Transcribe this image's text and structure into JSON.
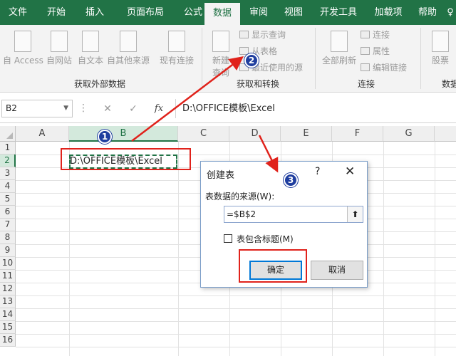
{
  "ribbon_tabs": [
    {
      "label": "文件"
    },
    {
      "label": "开始"
    },
    {
      "label": "插入"
    },
    {
      "label": "页面布局"
    },
    {
      "label": "公式"
    },
    {
      "label": "数据"
    },
    {
      "label": "审阅"
    },
    {
      "label": "视图"
    },
    {
      "label": "开发工具"
    },
    {
      "label": "加载项"
    },
    {
      "label": "帮助"
    },
    {
      "label": "♀"
    }
  ],
  "active_tab": "数据",
  "ribbon": {
    "external_data": {
      "group_label": "获取外部数据",
      "buttons": [
        {
          "label": "自 Access"
        },
        {
          "label": "自网站"
        },
        {
          "label": "自文本"
        },
        {
          "label": "自其他来源"
        },
        {
          "label": "现有连接"
        }
      ]
    },
    "transform": {
      "group_label": "获取和转换",
      "new_query_line1": "新建",
      "new_query_line2": "查询",
      "small": [
        {
          "label": "显示查询"
        },
        {
          "label": "从表格"
        },
        {
          "label": "最近使用的源"
        }
      ]
    },
    "connections": {
      "group_label": "连接",
      "refresh_label": "全部刷新",
      "small": [
        {
          "label": "连接"
        },
        {
          "label": "属性"
        },
        {
          "label": "编辑链接"
        }
      ]
    },
    "stocks": {
      "label": "股票",
      "group_label": "数据"
    }
  },
  "formula_bar": {
    "name_box": "B2",
    "cancel_glyph": "✕",
    "enter_glyph": "✓",
    "fx": "fx",
    "value": "D:\\OFFICE模板\\Excel"
  },
  "columns": [
    "A",
    "B",
    "C",
    "D",
    "E",
    "F",
    "G"
  ],
  "rows": [
    "1",
    "2",
    "3",
    "4",
    "5",
    "6",
    "7",
    "8",
    "9",
    "10",
    "11",
    "12",
    "13",
    "14",
    "15",
    "16"
  ],
  "selected_cell": "B2",
  "cell_b2": "D:\\OFFICE模板\\Excel",
  "dialog": {
    "title": "创建表",
    "help": "?",
    "close": "✕",
    "source_label": "表数据的来源(W):",
    "source_value": "=$B$2",
    "collapse_glyph": "⬆",
    "has_headers_label": "表包含标题(M)",
    "has_headers_checked": false,
    "ok_label": "确定",
    "cancel_label": "取消"
  },
  "annotations": [
    {
      "number": "1"
    },
    {
      "number": "2"
    },
    {
      "number": "3"
    }
  ],
  "colors": {
    "excel_green": "#217346",
    "annotation_red": "#e0221b",
    "badge_blue": "#1f3e9f"
  }
}
